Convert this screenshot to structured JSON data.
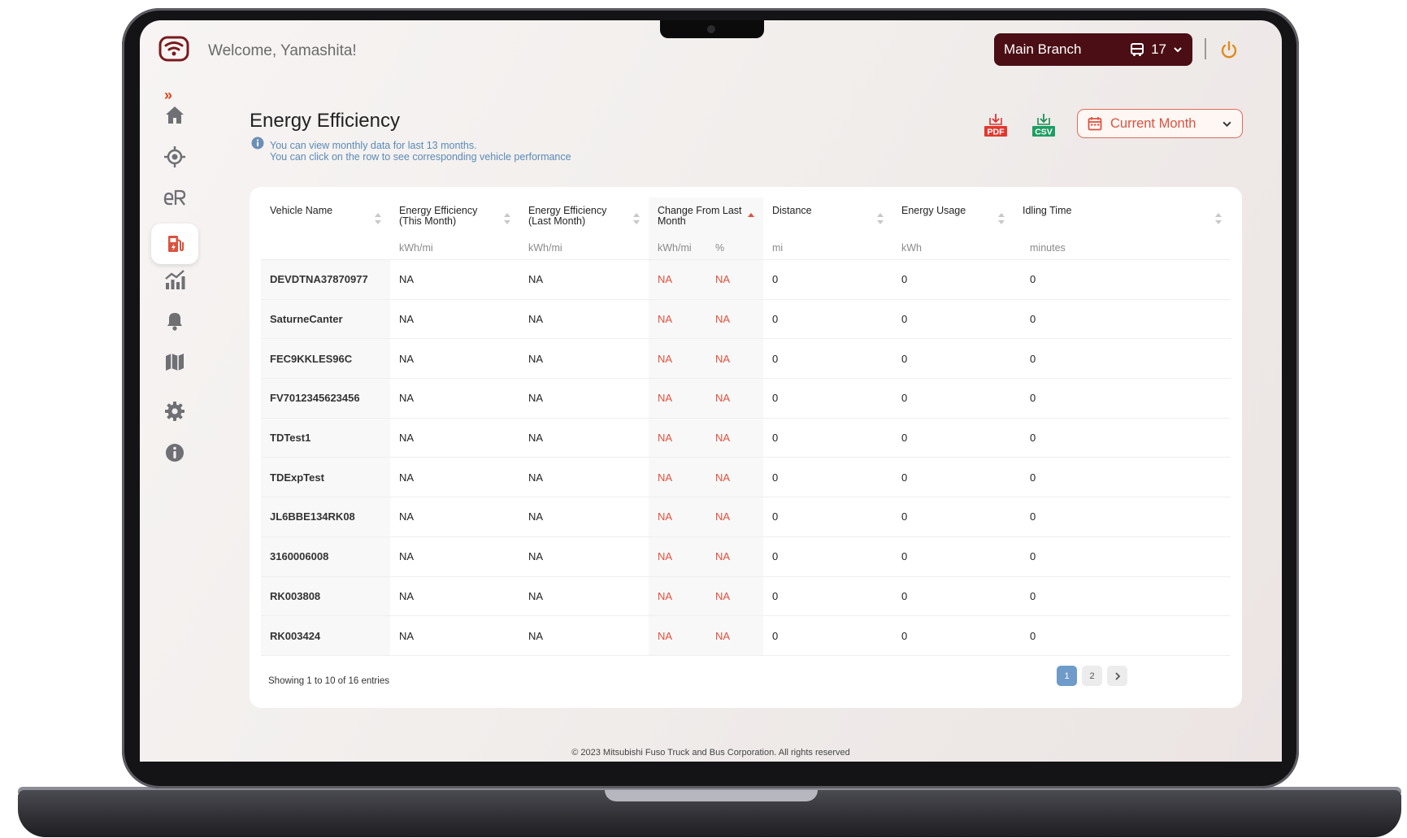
{
  "header": {
    "welcome": "Welcome, Yamashita!",
    "branch": "Main Branch",
    "vehicle_count": "17"
  },
  "page": {
    "title": "Energy Efficiency",
    "hint_line1": "You can view monthly data for last 13 months.",
    "hint_line2": "You can click on the row to see corresponding vehicle performance",
    "pdf_label": "PDF",
    "csv_label": "CSV",
    "period": "Current Month"
  },
  "table": {
    "columns": [
      {
        "l1": "Vehicle Name",
        "l2": "",
        "unit": ""
      },
      {
        "l1": "Energy Efficiency",
        "l2": "(This Month)",
        "unit": "kWh/mi"
      },
      {
        "l1": "Energy Efficiency",
        "l2": "(Last Month)",
        "unit": "kWh/mi"
      },
      {
        "l1": "Change From Last",
        "l2": "Month",
        "unit": "kWh/mi",
        "unit2": "%"
      },
      {
        "l1": "Distance",
        "l2": "",
        "unit": "mi"
      },
      {
        "l1": "Energy Usage",
        "l2": "",
        "unit": "kWh"
      },
      {
        "l1": "Idling Time",
        "l2": "",
        "unit": "minutes"
      }
    ],
    "rows": [
      {
        "name": "DEVDTNA37870977",
        "this": "NA",
        "last": "NA",
        "chg": "NA",
        "pct": "NA",
        "dist": "0",
        "usage": "0",
        "idle": "0"
      },
      {
        "name": "SaturneCanter",
        "this": "NA",
        "last": "NA",
        "chg": "NA",
        "pct": "NA",
        "dist": "0",
        "usage": "0",
        "idle": "0"
      },
      {
        "name": "FEC9KKLES96C",
        "this": "NA",
        "last": "NA",
        "chg": "NA",
        "pct": "NA",
        "dist": "0",
        "usage": "0",
        "idle": "0"
      },
      {
        "name": "FV7012345623456",
        "this": "NA",
        "last": "NA",
        "chg": "NA",
        "pct": "NA",
        "dist": "0",
        "usage": "0",
        "idle": "0"
      },
      {
        "name": "TDTest1",
        "this": "NA",
        "last": "NA",
        "chg": "NA",
        "pct": "NA",
        "dist": "0",
        "usage": "0",
        "idle": "0"
      },
      {
        "name": "TDExpTest",
        "this": "NA",
        "last": "NA",
        "chg": "NA",
        "pct": "NA",
        "dist": "0",
        "usage": "0",
        "idle": "0"
      },
      {
        "name": "JL6BBE134RK08",
        "this": "NA",
        "last": "NA",
        "chg": "NA",
        "pct": "NA",
        "dist": "0",
        "usage": "0",
        "idle": "0"
      },
      {
        "name": "3160006008",
        "this": "NA",
        "last": "NA",
        "chg": "NA",
        "pct": "NA",
        "dist": "0",
        "usage": "0",
        "idle": "0"
      },
      {
        "name": "RK003808",
        "this": "NA",
        "last": "NA",
        "chg": "NA",
        "pct": "NA",
        "dist": "0",
        "usage": "0",
        "idle": "0"
      },
      {
        "name": "RK003424",
        "this": "NA",
        "last": "NA",
        "chg": "NA",
        "pct": "NA",
        "dist": "0",
        "usage": "0",
        "idle": "0"
      }
    ],
    "footer": "Showing 1 to 10 of 16 entries",
    "pages": [
      "1",
      "2"
    ]
  },
  "footer": {
    "copyright": "© 2023 Mitsubishi Fuso Truck and Bus Corporation. All rights reserved"
  },
  "colors": {
    "brand": "#4a0e14",
    "accent": "#d9533f",
    "negative": "#e2503c",
    "page_active": "#6e9bc9"
  },
  "icons": {
    "sidebar": [
      "home-icon",
      "location-icon",
      "energy-report-icon",
      "ev-charging-icon",
      "analytics-icon",
      "bell-icon",
      "map-icon",
      "settings-icon",
      "info-icon"
    ]
  }
}
